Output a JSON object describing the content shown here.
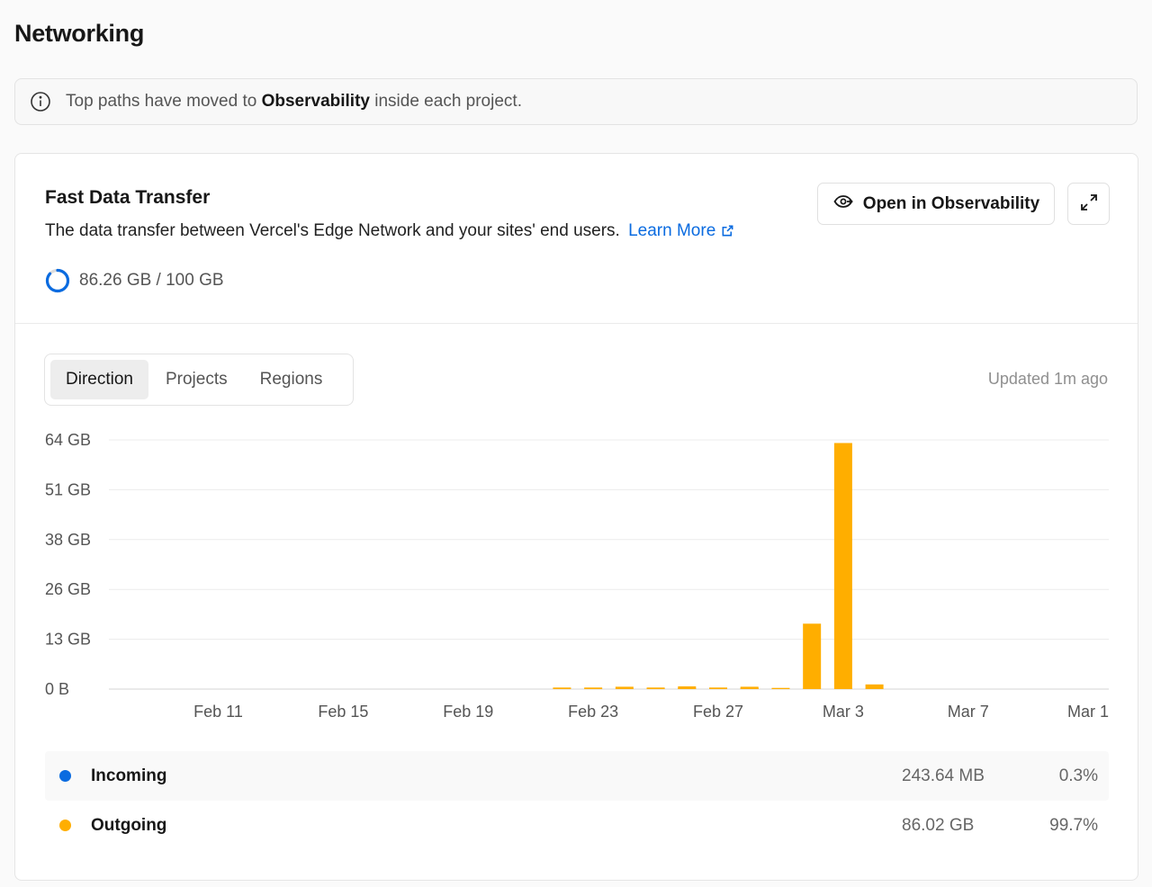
{
  "page": {
    "title": "Networking"
  },
  "notice": {
    "prefix": "Top paths have moved to ",
    "bold": "Observability",
    "suffix": " inside each project."
  },
  "card": {
    "title": "Fast Data Transfer",
    "description": "The data transfer between Vercel's Edge Network and your sites' end users.",
    "learn_more": "Learn More",
    "usage_text": "86.26 GB / 100 GB",
    "usage_fraction": 0.8626,
    "open_button": "Open in Observability"
  },
  "tabs": [
    {
      "label": "Direction",
      "active": true
    },
    {
      "label": "Projects",
      "active": false
    },
    {
      "label": "Regions",
      "active": false
    }
  ],
  "updated": "Updated 1m ago",
  "colors": {
    "incoming": "#0a6be0",
    "outgoing": "#ffae00",
    "link": "#0a6be0"
  },
  "chart_data": {
    "type": "bar",
    "y_ticks": [
      "0 B",
      "13 GB",
      "26 GB",
      "38 GB",
      "51 GB",
      "64 GB"
    ],
    "x_ticks": [
      "Feb 11",
      "Feb 15",
      "Feb 19",
      "Feb 23",
      "Feb 27",
      "Mar 3",
      "Mar 7",
      "Mar 1"
    ],
    "ylim": [
      0,
      64
    ],
    "grid": true,
    "series": [
      {
        "name": "Outgoing",
        "x": [
          "Feb 25",
          "Feb 26",
          "Feb 27",
          "Feb 28",
          "Mar 1",
          "Mar 2",
          "Mar 3",
          "Mar 4",
          "Mar 5",
          "Mar 6",
          "Mar 7",
          "Mar 8",
          "Mar 9",
          "Mar 10",
          "Mar 11"
        ],
        "values": [
          0.05,
          0.1,
          0.2,
          0.6,
          0.4,
          0.4,
          0.6,
          0.4,
          0.7,
          0.4,
          0.4,
          0.3,
          16.8,
          63.2,
          1.2
        ]
      }
    ]
  },
  "legend": [
    {
      "name": "Incoming",
      "value": "243.64 MB",
      "percent": "0.3%"
    },
    {
      "name": "Outgoing",
      "value": "86.02 GB",
      "percent": "99.7%"
    }
  ]
}
